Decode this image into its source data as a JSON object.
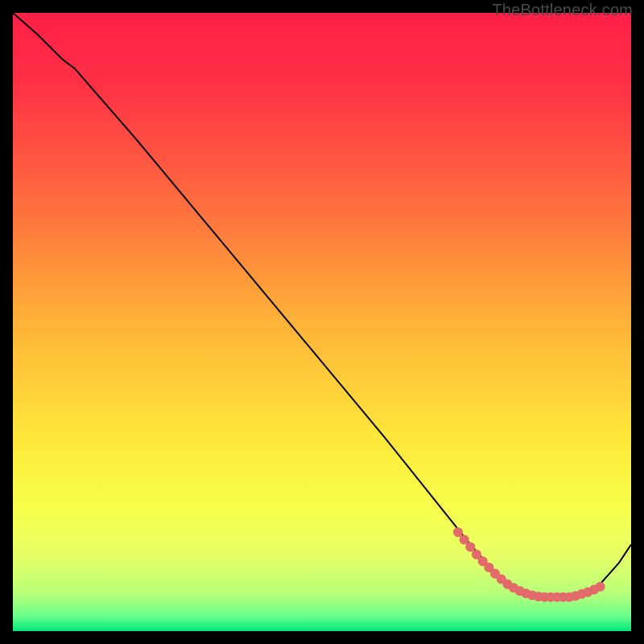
{
  "watermark": "TheBottleneck.com",
  "chart_data": {
    "type": "line",
    "title": "",
    "xlabel": "",
    "ylabel": "",
    "xlim": [
      0,
      100
    ],
    "ylim": [
      0,
      100
    ],
    "grid": false,
    "legend": false,
    "series": [
      {
        "name": "curve",
        "color": "#000000",
        "stroke_width": 2,
        "x": [
          0,
          4,
          8,
          10,
          20,
          30,
          40,
          50,
          60,
          70,
          74,
          78,
          82,
          86,
          90,
          94,
          98,
          100
        ],
        "y": [
          100,
          96.5,
          92.5,
          91,
          79.5,
          67.5,
          55.5,
          43.5,
          31.5,
          19,
          14,
          9.5,
          6.5,
          5.5,
          5.5,
          6.5,
          11,
          14
        ]
      }
    ],
    "markers": {
      "name": "valley-dots",
      "color": "#e26a6a",
      "radius": 6,
      "x": [
        72,
        73,
        74,
        75,
        76,
        77,
        78,
        79,
        80,
        81,
        82,
        83,
        84,
        85,
        86,
        87,
        88,
        89,
        90,
        91,
        92,
        93,
        94,
        95
      ],
      "y": [
        16.0,
        14.8,
        13.6,
        12.4,
        11.3,
        10.3,
        9.3,
        8.4,
        7.6,
        7.0,
        6.5,
        6.1,
        5.8,
        5.6,
        5.5,
        5.5,
        5.5,
        5.5,
        5.5,
        5.7,
        6.0,
        6.3,
        6.7,
        7.2
      ]
    },
    "background_gradient": {
      "stops": [
        {
          "offset": 0.0,
          "color": "#ff1f47"
        },
        {
          "offset": 0.12,
          "color": "#ff3246"
        },
        {
          "offset": 0.3,
          "color": "#ff6a3f"
        },
        {
          "offset": 0.5,
          "color": "#ffb238"
        },
        {
          "offset": 0.68,
          "color": "#ffe53a"
        },
        {
          "offset": 0.8,
          "color": "#f7ff4a"
        },
        {
          "offset": 0.88,
          "color": "#e6ff66"
        },
        {
          "offset": 0.94,
          "color": "#b6ff7a"
        },
        {
          "offset": 0.975,
          "color": "#6bff8a"
        },
        {
          "offset": 1.0,
          "color": "#00e676"
        }
      ]
    }
  }
}
